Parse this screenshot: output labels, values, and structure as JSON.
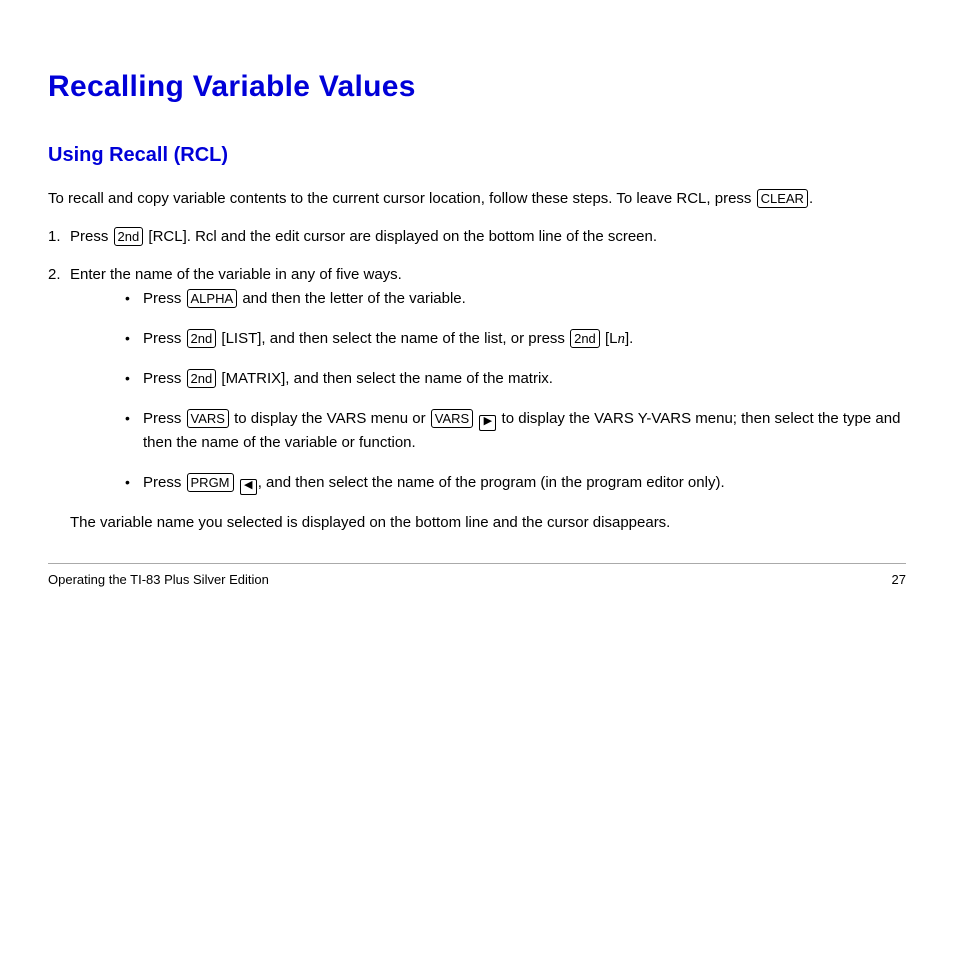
{
  "heading": "Recalling Variable Values",
  "subhead": "Using Recall (RCL)",
  "intro": "To recall and copy variable contents to the current cursor location, follow these steps. To leave RCL, press ",
  "intro_tail": ".",
  "key_clear": "CLEAR",
  "step1_a": "Press ",
  "key_2nd": "2nd",
  "key_rcl_open": "[",
  "key_rcl_inner": "RCL",
  "key_rcl_close": "]",
  "step1_b": ". Rcl and the edit cursor are displayed on the bottom line of the screen.",
  "step2": "Enter the name of the variable in any of five ways.",
  "b1_a": "Press ",
  "key_alpha": "ALPHA",
  "b1_b": " and then the letter of the variable.",
  "b2_a": "Press ",
  "key_list_inner": "LIST",
  "b2_b": ", and then select the name of the list, or press ",
  "b2_c": " [L",
  "b2_emph": "n",
  "b2_d": "].",
  "b3_a": "Press ",
  "key_matrix": "MATRIX",
  "b3_b": ", and then select the name of the matrix.",
  "b4_a": "Press ",
  "key_vars": "VARS",
  "b4_b": " to display the VARS menu or ",
  "b4_c": " to display the VARS Y",
  "b4_d": "VARS menu; then select the type and then the name of the variable or function.",
  "yvars_dash": "-",
  "b5_a": "Press ",
  "key_prgm": "PRGM",
  "b5_b": ", and then select the name of the program (in the program editor only).",
  "step2_tail": "The variable name you selected is displayed on the bottom line and the cursor disappears.",
  "arrow_right": "▶",
  "arrow_left": "◀",
  "footer_left": "Operating the TI-83 Plus Silver Edition",
  "footer_right": "27"
}
